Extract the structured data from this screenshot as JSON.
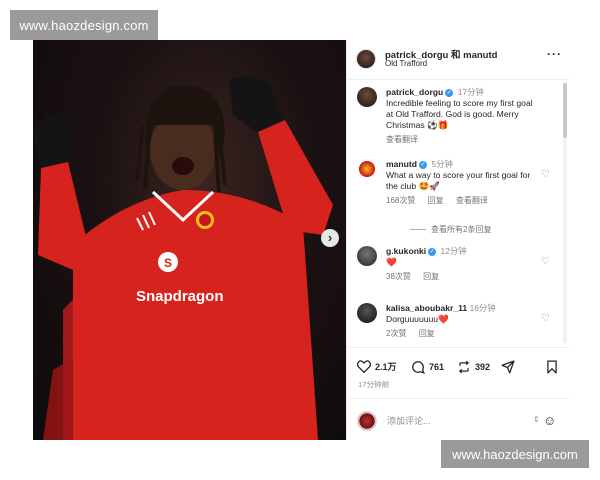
{
  "watermark": {
    "top": "www.haozdesign.com",
    "bottom": "www.haozdesign.com"
  },
  "photo": {
    "jersey_text": "Snapdragon",
    "carousel_total": 4,
    "carousel_active": 1
  },
  "post": {
    "header_title": "patrick_dorgu 和 manutd",
    "header_location": "Old Trafford",
    "more_icon": "more-horizontal-icon",
    "caption": {
      "user": "patrick_dorgu",
      "time": "17分钟",
      "text": "Incredible feeling to score my first goal at Old Trafford. God is good. Merry Christmas ⚽🎁",
      "translate": "查看翻译"
    },
    "comments": [
      {
        "user": "manutd",
        "verified": true,
        "time": "5分钟",
        "text": "What a way to score your first goal for the club 🤩🚀",
        "likes": "168次赞",
        "reply": "回复",
        "translate": "查看翻译",
        "view_replies": "查看所有2条回复"
      },
      {
        "user": "g.kukonki",
        "verified": true,
        "time": "12分钟",
        "text": "❤️",
        "likes": "38次赞",
        "reply": "回复"
      },
      {
        "user": "kalisa_aboubakr_11",
        "verified": false,
        "time": "16分钟",
        "text": "Dorguuuuuuu❤️",
        "likes": "2次赞",
        "reply": "回复"
      }
    ],
    "actions": {
      "likes": "2.1万",
      "comments": "761",
      "reposts": "392"
    },
    "time_ago": "17分钟前",
    "add_comment_placeholder": "添加评论..."
  },
  "colors": {
    "verified": "#3897f0",
    "jersey_red": "#d7231d",
    "muted": "#8e8e8e"
  }
}
